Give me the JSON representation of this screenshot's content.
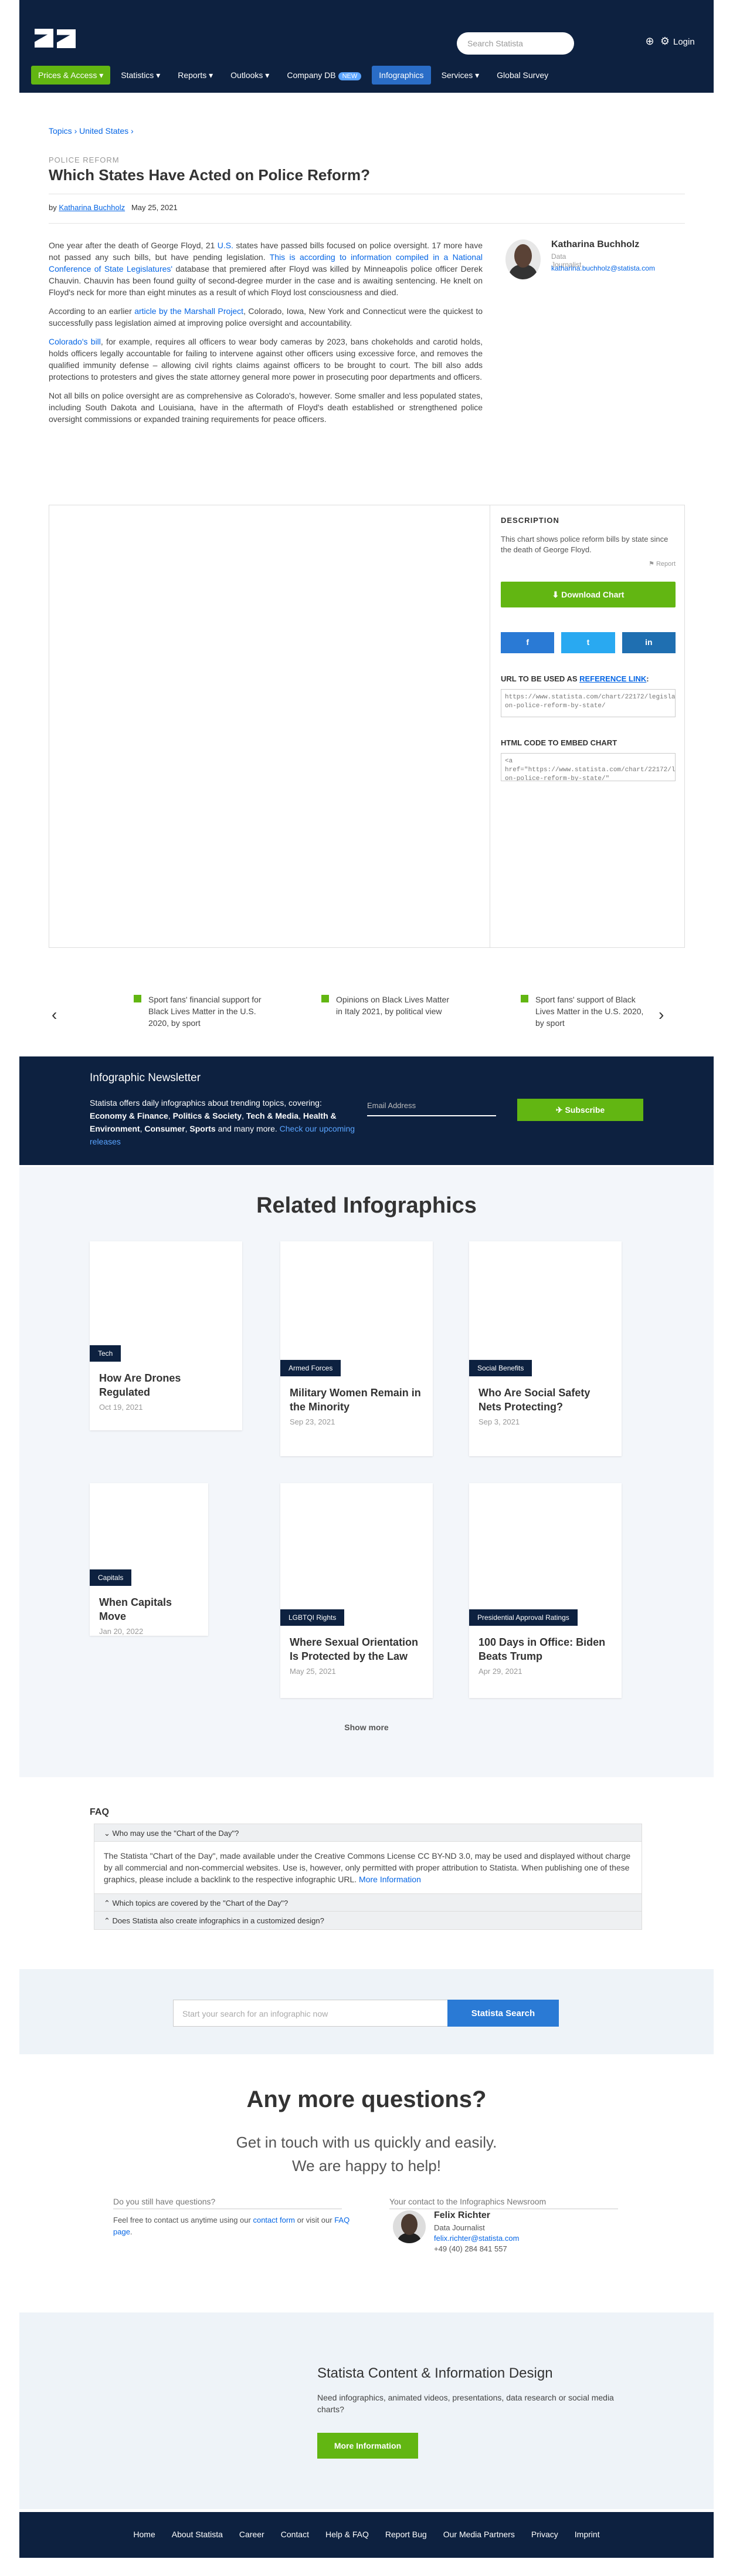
{
  "header": {
    "logo": "Statista",
    "search_placeholder": "Search Statista",
    "login": "Login",
    "nav": [
      "Prices & Access ▾",
      "Statistics ▾",
      "Reports ▾",
      "Outlooks ▾",
      "Company DB",
      "Infographics",
      "Services ▾",
      "Global Survey"
    ],
    "new_badge": "NEW"
  },
  "breadcrumb": "Topics › United States ›",
  "category": "POLICE REFORM",
  "title": "Which States Have Acted on Police Reform?",
  "byline": {
    "by": "by",
    "author": "Katharina Buchholz",
    "date": "May 25, 2021"
  },
  "article": {
    "p1_a": "One year after the death of George Floyd, 21 ",
    "p1_link1": "U.S.",
    "p1_b": " states have passed bills focused on police oversight. 17 more have not passed any such bills, but have pending legislation. ",
    "p1_link2": "This is according to information compiled in a National Conference of State Legislatures'",
    "p1_c": " database that premiered after Floyd was killed by Minneapolis police officer Derek Chauvin. Chauvin has been found guilty of second-degree murder in the case and is awaiting sentencing. He knelt on Floyd's neck for more than eight minutes as a result of which Floyd lost consciousness and died.",
    "p2_a": "According to an earlier ",
    "p2_link": "article by the Marshall Project",
    "p2_b": ", Colorado, Iowa, New York and Connecticut were the quickest to successfully pass legislation aimed at improving police oversight and accountability.",
    "p3_link": "Colorado's bill",
    "p3_b": ", for example, requires all officers to wear body cameras by 2023, bans chokeholds and carotid holds, holds officers legally accountable for failing to intervene against other officers using excessive force, and removes the qualified immunity defense – allowing civil rights claims against officers to be brought to court. The bill also adds protections to protesters and gives the state attorney general more power in prosecuting poor departments and officers.",
    "p4": "Not all bills on police oversight are as comprehensive as Colorado's, however. Some smaller and less populated states, including South Dakota and Louisiana, have in the aftermath of Floyd's death established or strengthened police oversight commissions or expanded training requirements for peace officers."
  },
  "author_box": {
    "name": "Katharina Buchholz",
    "role": "Data Journalist",
    "email": "katharina.buchholz@statista.com"
  },
  "chart_side": {
    "desc_h": "DESCRIPTION",
    "desc": "This chart shows police reform bills by state since the death of George Floyd.",
    "report": "⚑ Report",
    "download": "⬇ Download Chart",
    "share": [
      "f",
      "t",
      "in"
    ],
    "url_h": "URL TO BE USED AS ",
    "url_link": "REFERENCE LINK",
    "url_colon": ":",
    "url": "https://www.statista.com/chart/22172/legislation-on-police-reform-by-state/",
    "embed_h": "HTML CODE TO EMBED CHART",
    "embed": "<a href=\"https://www.statista.com/chart/22172/legislation-on-police-reform-by-state/\""
  },
  "slider": [
    {
      "text": "Sport fans' financial support for Black Lives Matter in the U.S. 2020, by sport"
    },
    {
      "text": "Opinions on Black Lives Matter in Italy 2021, by political view"
    },
    {
      "text": "Sport fans' support of Black Lives Matter in the U.S. 2020, by sport"
    }
  ],
  "newsletter": {
    "title": "Infographic Newsletter",
    "d1": "Statista offers daily infographics about trending topics, covering: ",
    "d2": "Economy & Finance",
    "d3": ", ",
    "d4": "Politics & Society",
    "d5": ", ",
    "d6": "Tech & Media",
    "d7": ", ",
    "d8": "Health & Environment",
    "d9": ", ",
    "d10": "Consumer",
    "d11": ", ",
    "d12": "Sports",
    "d13": " and many more. ",
    "d14": "Check our upcoming releases",
    "email": "Email Address",
    "subscribe": "✈ Subscribe"
  },
  "related": {
    "heading": "Related Infographics",
    "cards": [
      {
        "tag": "Tech",
        "title": "How Are Drones Regulated",
        "date": "Oct 19, 2021"
      },
      {
        "tag": "Armed Forces",
        "title": "Military Women Remain in the Minority",
        "date": "Sep 23, 2021"
      },
      {
        "tag": "Social Benefits",
        "title": "Who Are Social Safety Nets Protecting?",
        "date": "Sep 3, 2021"
      },
      {
        "tag": "Capitals",
        "title": "When Capitals Move",
        "date": "Jan 20, 2022"
      },
      {
        "tag": "LGBTQI Rights",
        "title": "Where Sexual Orientation Is Protected by the Law",
        "date": "May 25, 2021"
      },
      {
        "tag": "Presidential Approval Ratings",
        "title": "100 Days in Office: Biden Beats Trump",
        "date": "Apr 29, 2021"
      }
    ],
    "show_more": "Show more"
  },
  "faq": {
    "heading": "FAQ",
    "q1": "⌄ Who may use the \"Chart of the Day\"?",
    "a1": "The Statista \"Chart of the Day\", made available under the Creative Commons License CC BY-ND 3.0, may be used and displayed without charge by all commercial and non-commercial websites. Use is, however, only permitted with proper attribution to Statista. When publishing one of these graphics, please include a backlink to the respective infographic URL. ",
    "a1_link": "More Information",
    "q2": "⌃ Which topics are covered by the \"Chart of the Day\"?",
    "q3": "⌃ Does Statista also create infographics in a customized design?"
  },
  "search_row": {
    "placeholder": "Start your search for an infographic now",
    "button": "Statista Search"
  },
  "contact": {
    "heading": "Any more questions?",
    "sub1": "Get in touch with us quickly and easily.",
    "sub2": "We are happy to help!",
    "col1_h": "Do you still have questions?",
    "col1_a": "Feel free to contact us anytime using our ",
    "col1_link1": "contact form",
    "col1_b": " or visit our ",
    "col1_link2": "FAQ page",
    "col1_c": ".",
    "col2_h": "Your contact to the Infographics Newsroom",
    "name": "Felix Richter",
    "role": "Data Journalist",
    "email": "felix.richter@statista.com",
    "phone": "+49 (40) 284 841 557"
  },
  "design": {
    "title": "Statista Content & Information Design",
    "text": "Need infographics, animated videos, presentations, data research or social media charts?",
    "button": "More Information"
  },
  "footer": [
    "Home",
    "About Statista",
    "Career",
    "Contact",
    "Help & FAQ",
    "Report Bug",
    "Our Media Partners",
    "Privacy",
    "Imprint"
  ],
  "colors": {
    "navy": "#0d2140",
    "green": "#62b612",
    "blue": "#0666e5"
  }
}
